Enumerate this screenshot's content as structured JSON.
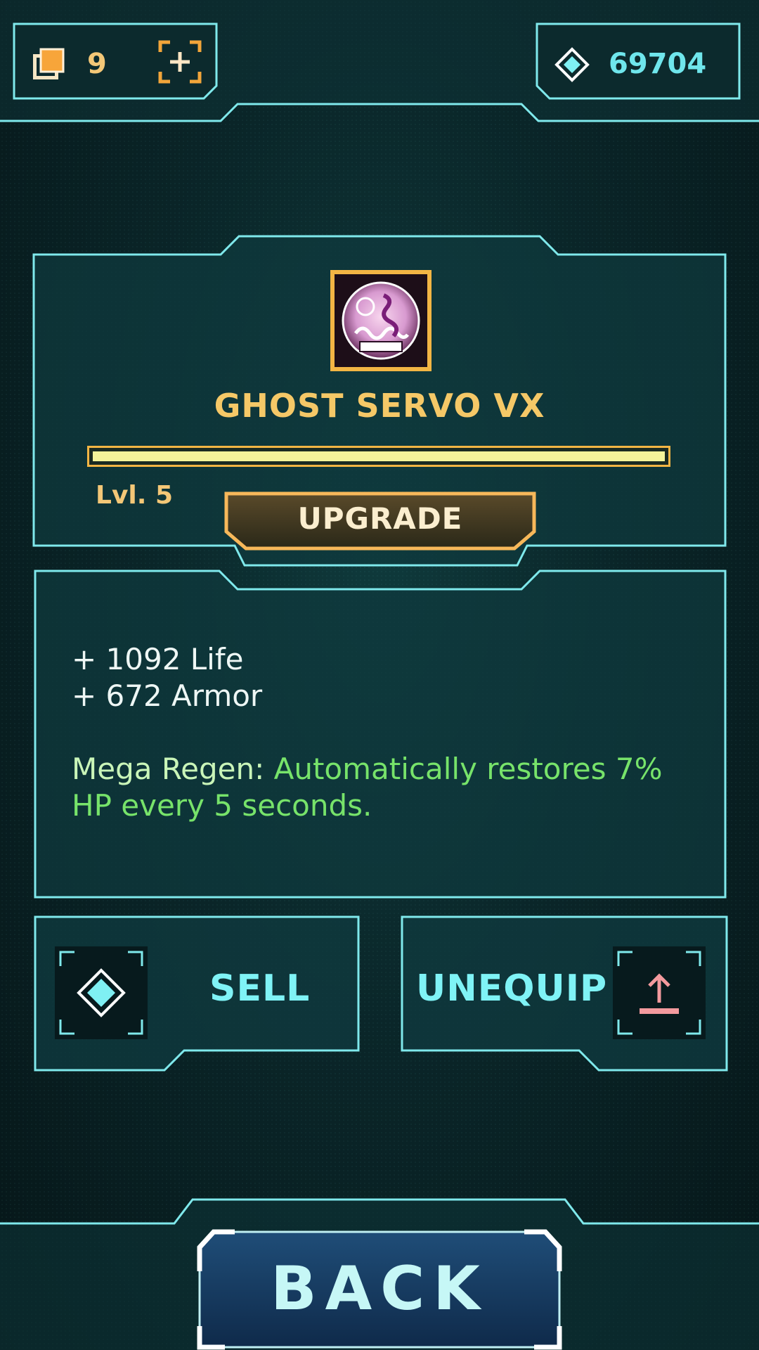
{
  "header": {
    "cards_count": "9",
    "gems_count": "69704"
  },
  "item": {
    "name": "GHOST SERVO VX",
    "level_label": "Lvl. 5",
    "xp_progress": 1.0,
    "upgrade_label": "UPGRADE"
  },
  "stats": {
    "lines": [
      "+ 1092 Life",
      "+ 672 Armor"
    ],
    "ability_name": "Mega Regen: ",
    "ability_desc": "Automatically restores 7% HP every 5 seconds."
  },
  "actions": {
    "sell_label": "SELL",
    "unequip_label": "UNEQUIP",
    "back_label": "BACK"
  },
  "colors": {
    "accent_cyan": "#6fe6ec",
    "accent_gold": "#f2b544",
    "ability_green": "#77e36a"
  },
  "icons": {
    "cards": "cards-stack-icon",
    "add": "add-plus-icon",
    "gem": "diamond-gem-icon",
    "item": "ghost-servo-item-icon",
    "sell": "diamond-gem-icon",
    "unequip": "upload-arrow-icon"
  }
}
